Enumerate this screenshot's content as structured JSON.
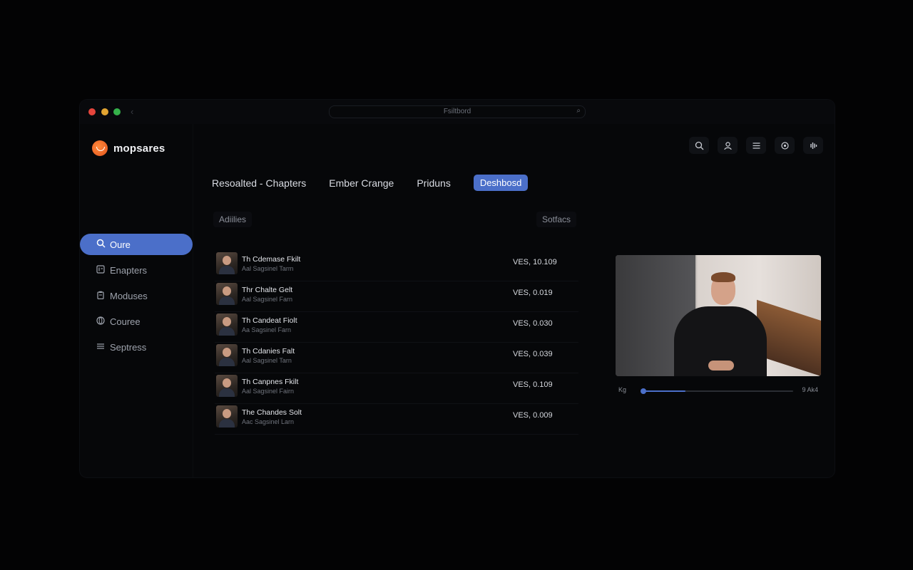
{
  "window": {
    "address": "Fsiltbord"
  },
  "brand": {
    "name": "mopsares"
  },
  "sidebar": {
    "items": [
      {
        "label": "Oure",
        "icon": "search-icon",
        "active": true
      },
      {
        "label": "Enapters",
        "icon": "chapters-icon",
        "active": false
      },
      {
        "label": "Moduses",
        "icon": "clipboard-icon",
        "active": false
      },
      {
        "label": "Couree",
        "icon": "globe-icon",
        "active": false
      },
      {
        "label": "Septress",
        "icon": "menu-icon",
        "active": false
      }
    ]
  },
  "toolbar": {
    "icons": [
      "search-icon",
      "user-icon",
      "list-icon",
      "settings-icon",
      "audio-icon"
    ]
  },
  "tabs": [
    {
      "label": "Resoalted - Chapters",
      "active": false
    },
    {
      "label": "Ember Crange",
      "active": false
    },
    {
      "label": "Priduns",
      "active": false
    },
    {
      "label": "Deshbosd",
      "active": true
    }
  ],
  "list_header": {
    "left": "Adiilies",
    "right": "Sotfacs"
  },
  "rows": [
    {
      "title": "Th Cdemase Fkilt",
      "subtitle": "Aal Sagsinel Tarm",
      "value": "VES, 10.109"
    },
    {
      "title": "Thr Chalte Gelt",
      "subtitle": "Aal Sagsinel Farn",
      "value": "VES, 0.019"
    },
    {
      "title": "Th Candeat Fiolt",
      "subtitle": "Aa Sagsinel Farn",
      "value": "VES, 0.030"
    },
    {
      "title": "Th Cdanies Falt",
      "subtitle": "Aal Sagsinel Tarn",
      "value": "VES, 0.039"
    },
    {
      "title": "Th Canpnes Fkilt",
      "subtitle": "Aal Sagsinel Fairn",
      "value": "VES, 0.109"
    },
    {
      "title": "The Chandes Solt",
      "subtitle": "Aac Sagsinel Larn",
      "value": "VES, 0.009"
    }
  ],
  "player": {
    "elapsed": "Kg",
    "remaining": "9 Ak4",
    "progress": 0.28,
    "accent": "#4b6fc9"
  }
}
